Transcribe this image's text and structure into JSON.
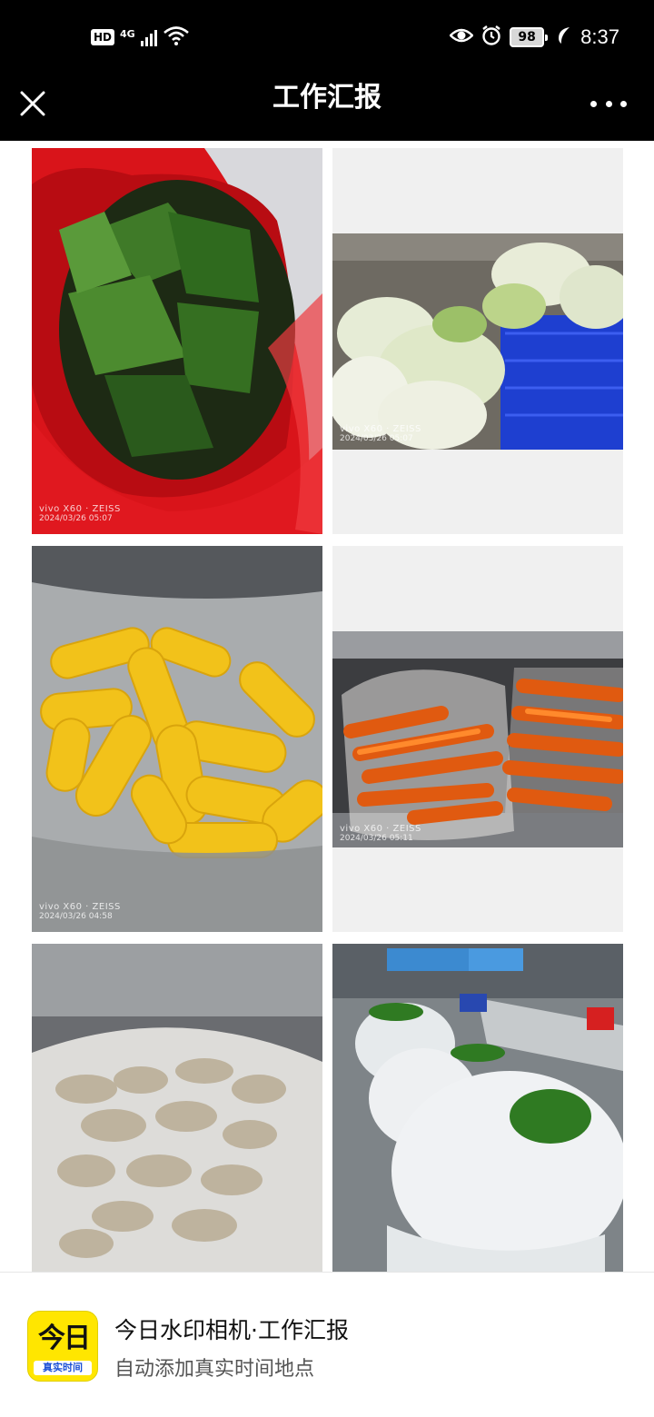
{
  "status_bar": {
    "hd_badge": "HD",
    "network": "4G",
    "battery_level": "98",
    "time": "8:37",
    "icons": [
      "signal-icon",
      "wifi-icon",
      "eye-icon",
      "alarm-icon",
      "battery-icon",
      "leaf-icon"
    ]
  },
  "nav": {
    "title": "工作汇报",
    "close_icon": "close-icon",
    "more_icon": "more-icon"
  },
  "photos": [
    {
      "subject": "kelp",
      "watermark_camera": "vivo X60 · ZEISS",
      "watermark_date": "2024/03/26 05:07"
    },
    {
      "subject": "napa-cabbage",
      "watermark_camera": "vivo X60 · ZEISS",
      "watermark_date": "2024/03/26 05:07"
    },
    {
      "subject": "corn",
      "watermark_camera": "vivo X60 · ZEISS",
      "watermark_date": "2024/03/26 04:58"
    },
    {
      "subject": "carrots",
      "watermark_camera": "vivo X60 · ZEISS",
      "watermark_date": "2024/03/26 05:11"
    },
    {
      "subject": "taro",
      "watermark_camera": "",
      "watermark_date": ""
    },
    {
      "subject": "leafy-greens",
      "watermark_camera": "",
      "watermark_date": ""
    }
  ],
  "banner": {
    "app_icon_text": "今日",
    "app_icon_tag": "真实时间",
    "title": "今日水印相机·工作汇报",
    "subtitle": "自动添加真实时间地点"
  },
  "colors": {
    "bar_background": "#000000",
    "page_background": "#ffffff",
    "app_icon_yellow": "#ffe600"
  }
}
